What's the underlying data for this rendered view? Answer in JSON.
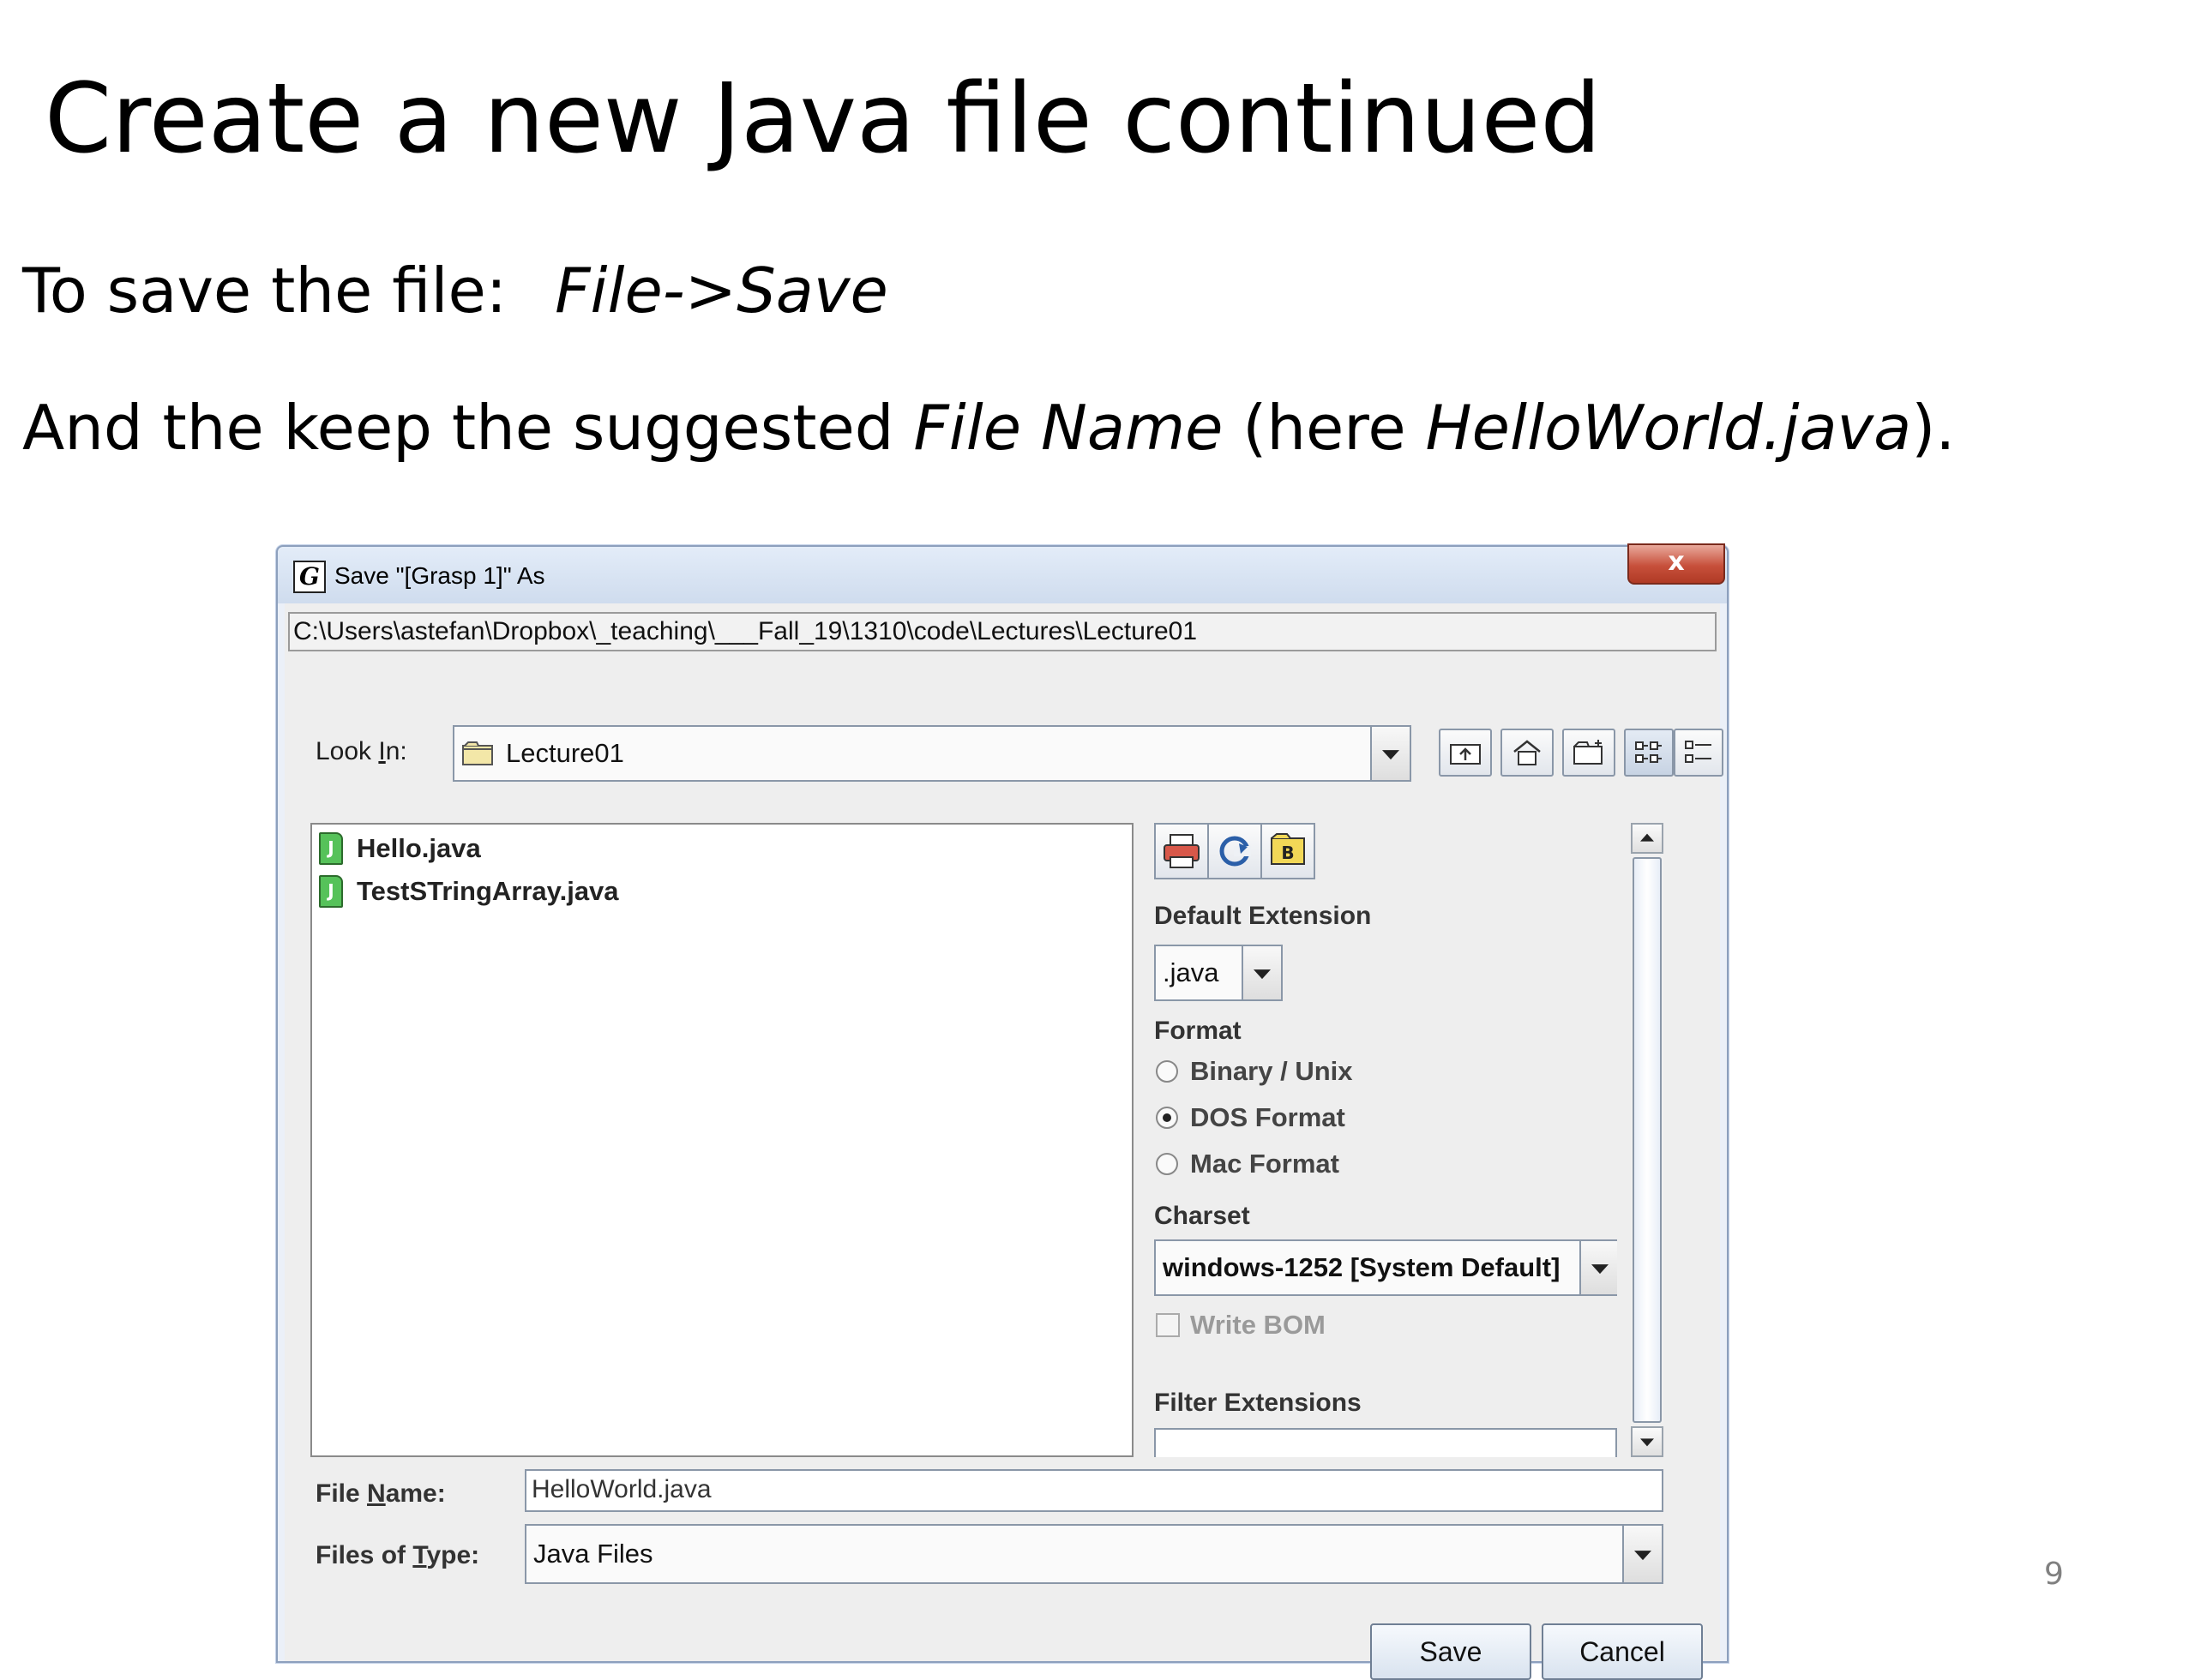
{
  "slide": {
    "title": "Create a new Java file continued",
    "line1_prefix": "To save the file:",
    "line1_italic": "File->Save",
    "line2_a": "And the keep the suggested ",
    "line2_b": "File Name",
    "line2_c": " (here ",
    "line2_d": "HelloWorld.java",
    "line2_e": ").",
    "page_number": "9"
  },
  "dialog": {
    "title": "Save \"[Grasp 1]\" As",
    "close_glyph": "x",
    "current_path": "C:\\Users\\astefan\\Dropbox\\_teaching\\___Fall_19\\1310\\code\\Lectures\\Lecture01",
    "look_in": {
      "label_pre": "Look ",
      "label_mnemonic": "I",
      "label_post": "n:",
      "value": "Lecture01"
    },
    "toolbar_icons": [
      "up-folder-icon",
      "home-icon",
      "new-folder-icon",
      "list-view-icon",
      "details-view-icon"
    ],
    "files": [
      {
        "name": "Hello.java",
        "icon": "java-file-icon"
      },
      {
        "name": "TestSTringArray.java",
        "icon": "java-file-icon"
      }
    ],
    "options": {
      "icon_buttons": [
        "print-icon",
        "refresh-icon",
        "bookmark-icon"
      ],
      "default_extension_label": "Default Extension",
      "default_extension_value": ".java",
      "format_label": "Format",
      "formats": [
        {
          "label": "Binary / Unix",
          "selected": false
        },
        {
          "label": "DOS Format",
          "selected": true
        },
        {
          "label": "Mac Format",
          "selected": false
        }
      ],
      "charset_label": "Charset",
      "charset_value": "windows-1252 [System Default]",
      "write_bom_label": "Write BOM",
      "filter_extensions_label": "Filter Extensions"
    },
    "file_name": {
      "label_pre": "File ",
      "label_mnemonic": "N",
      "label_post": "ame:",
      "value": "HelloWorld.java"
    },
    "files_of_type": {
      "label_pre": "Files of ",
      "label_mnemonic": "T",
      "label_post": "ype:",
      "value": "Java Files"
    },
    "save_button": "Save",
    "cancel_button": "Cancel"
  }
}
